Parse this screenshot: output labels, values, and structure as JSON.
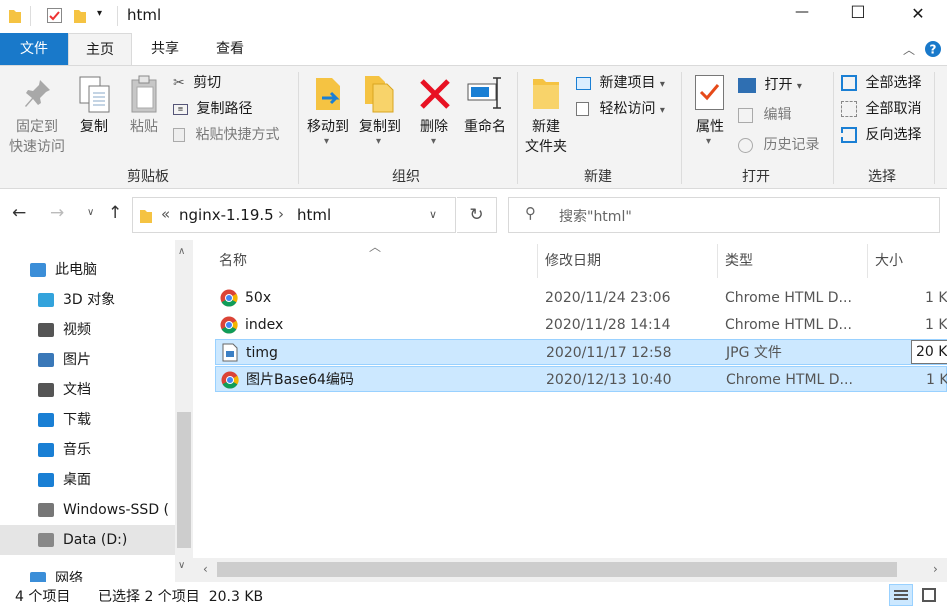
{
  "window": {
    "title": "html",
    "controls": {
      "minimize": "—",
      "maximize": "☐",
      "close": "✕"
    }
  },
  "tabs": {
    "file": "文件",
    "home": "主页",
    "share": "共享",
    "view": "查看"
  },
  "ribbon": {
    "clipboard": {
      "group_label": "剪贴板",
      "pin_quick_access": "固定到\n快速访问",
      "copy": "复制",
      "paste": "粘贴",
      "cut": "剪切",
      "copy_path": "复制路径",
      "paste_shortcut": "粘贴快捷方式"
    },
    "organize": {
      "group_label": "组织",
      "move_to": "移动到",
      "copy_to": "复制到",
      "delete": "删除",
      "rename": "重命名"
    },
    "new": {
      "group_label": "新建",
      "new_folder": "新建\n文件夹",
      "new_item": "新建项目",
      "easy_access": "轻松访问"
    },
    "open": {
      "group_label": "打开",
      "properties": "属性",
      "open": "打开",
      "edit": "编辑",
      "history": "历史记录"
    },
    "select": {
      "group_label": "选择",
      "select_all": "全部选择",
      "select_none": "全部取消",
      "invert": "反向选择"
    }
  },
  "address": {
    "overflow": "«",
    "crumbs": [
      "nginx-1.19.5",
      "html"
    ],
    "separator": "›",
    "search_placeholder": "搜索\"html\""
  },
  "nav": {
    "items": [
      {
        "label": "此电脑",
        "icon": "this-pc-icon"
      },
      {
        "label": "3D 对象",
        "icon": "3d-objects-icon"
      },
      {
        "label": "视频",
        "icon": "videos-icon"
      },
      {
        "label": "图片",
        "icon": "pictures-icon"
      },
      {
        "label": "文档",
        "icon": "documents-icon"
      },
      {
        "label": "下载",
        "icon": "downloads-icon"
      },
      {
        "label": "音乐",
        "icon": "music-icon"
      },
      {
        "label": "桌面",
        "icon": "desktop-icon"
      },
      {
        "label": "Windows-SSD (",
        "icon": "drive-c-icon"
      },
      {
        "label": "Data (D:)",
        "icon": "drive-d-icon"
      },
      {
        "label": "网络",
        "icon": "network-icon"
      }
    ]
  },
  "columns": {
    "name": "名称",
    "modified": "修改日期",
    "type": "类型",
    "size": "大小"
  },
  "files": [
    {
      "name": "50x",
      "modified": "2020/11/24 23:06",
      "type": "Chrome HTML D...",
      "size": "1 K",
      "icon": "chrome-icon",
      "selected": false
    },
    {
      "name": "index",
      "modified": "2020/11/28 14:14",
      "type": "Chrome HTML D...",
      "size": "1 K",
      "icon": "chrome-icon",
      "selected": false
    },
    {
      "name": "timg",
      "modified": "2020/11/17 12:58",
      "type": "JPG 文件",
      "size": "20 K",
      "icon": "jpg-file-icon",
      "selected": true
    },
    {
      "name": "图片Base64编码",
      "modified": "2020/12/13 10:40",
      "type": "Chrome HTML D...",
      "size": "1 K",
      "icon": "chrome-icon",
      "selected": true
    }
  ],
  "status": {
    "item_count": "4 个项目",
    "selection": "已选择 2 个项目  20.3 KB"
  },
  "colors": {
    "accent": "#1979ca",
    "selection": "#cce8ff",
    "selection_border": "#99d1ff",
    "delete_red": "#e81123",
    "folder": "#f5c342"
  }
}
